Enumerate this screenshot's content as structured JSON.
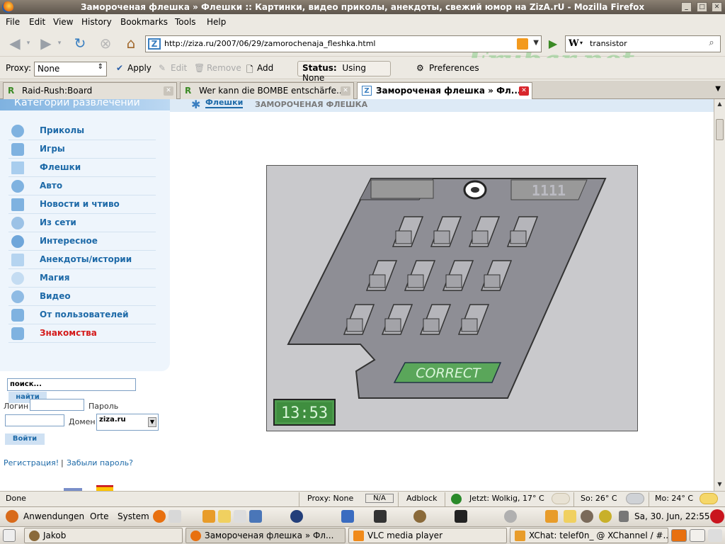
{
  "window": {
    "title": "Замороченая флешка » Флешки :: Картинки, видео приколы, анекдоты, свежий юмор на ZizA.rU - Mozilla Firefox"
  },
  "menubar": {
    "items": [
      "File",
      "Edit",
      "View",
      "History",
      "Bookmarks",
      "Tools",
      "Help"
    ]
  },
  "navbar": {
    "url": "http://ziza.ru/2007/06/29/zamorochenaja_fleshka.html",
    "search_value": "transistor",
    "search_engine": "W"
  },
  "watermark": "Frubar.net",
  "proxybar": {
    "label": "Proxy:",
    "selected": "None",
    "apply": "Apply",
    "edit": "Edit",
    "remove": "Remove",
    "add": "Add",
    "status_label": "Status:",
    "status_value": "Using None",
    "preferences": "Preferences"
  },
  "tabs": [
    {
      "label": "Raid-Rush:Board",
      "icon": "R"
    },
    {
      "label": "Wer kann die BOMBE entschärfe...",
      "icon": "R"
    },
    {
      "label": "Замороченая флешка » Фл...",
      "icon": "Z"
    }
  ],
  "sidebar": {
    "header": "Категории развлечений",
    "items": [
      {
        "label": "Приколы",
        "icon": "smile-icon"
      },
      {
        "label": "Игры",
        "icon": "person-icon"
      },
      {
        "label": "Флешки",
        "icon": "film-icon"
      },
      {
        "label": "Авто",
        "icon": "wheel-icon"
      },
      {
        "label": "Новости и чтиво",
        "icon": "book-icon"
      },
      {
        "label": "Из сети",
        "icon": "network-icon"
      },
      {
        "label": "Интересное",
        "icon": "star-icon"
      },
      {
        "label": "Анекдоты/истории",
        "icon": "smile-icon"
      },
      {
        "label": "Магия",
        "icon": "wand-icon"
      },
      {
        "label": "Видео",
        "icon": "disc-icon"
      },
      {
        "label": "От пользователей",
        "icon": "users-icon"
      },
      {
        "label": "Знакомства",
        "icon": "users-icon",
        "highlight": true
      }
    ]
  },
  "breadcrumb": {
    "section": "Флешки",
    "page": "ЗАМОРОЧЕНАЯ ФЛЕШКА"
  },
  "game": {
    "display_code": "1111",
    "correct_label": "CORRECT",
    "timer": "13:53"
  },
  "login": {
    "search_placeholder": "поиск...",
    "search_button": "найти",
    "login_label": "Логин",
    "password_label": "Пароль",
    "domain_label": "Домен",
    "domain_value": "ziza.ru",
    "submit": "Войти",
    "register": "Регистрация!",
    "separator": "|",
    "forgot": "Забыли пароль?"
  },
  "statusbar": {
    "status": "Done",
    "proxy": "Proxy: None",
    "na": "N/A",
    "adblock": "Adblock",
    "weather_now": "Jetzt: Wolkig, 17° C",
    "weather_sun": "So: 26° C",
    "weather_mon": "Mo: 24° C"
  },
  "panel": {
    "apps": "Anwendungen",
    "places": "Orte",
    "system": "System",
    "clock": "Sa, 30. Jun, 22:55"
  },
  "taskbar": [
    {
      "label": "Jakob"
    },
    {
      "label": "Замороченая флешка » Фл..."
    },
    {
      "label": "VLC media player"
    },
    {
      "label": "XChat: telef0n_ @ XChannel / #..."
    }
  ]
}
